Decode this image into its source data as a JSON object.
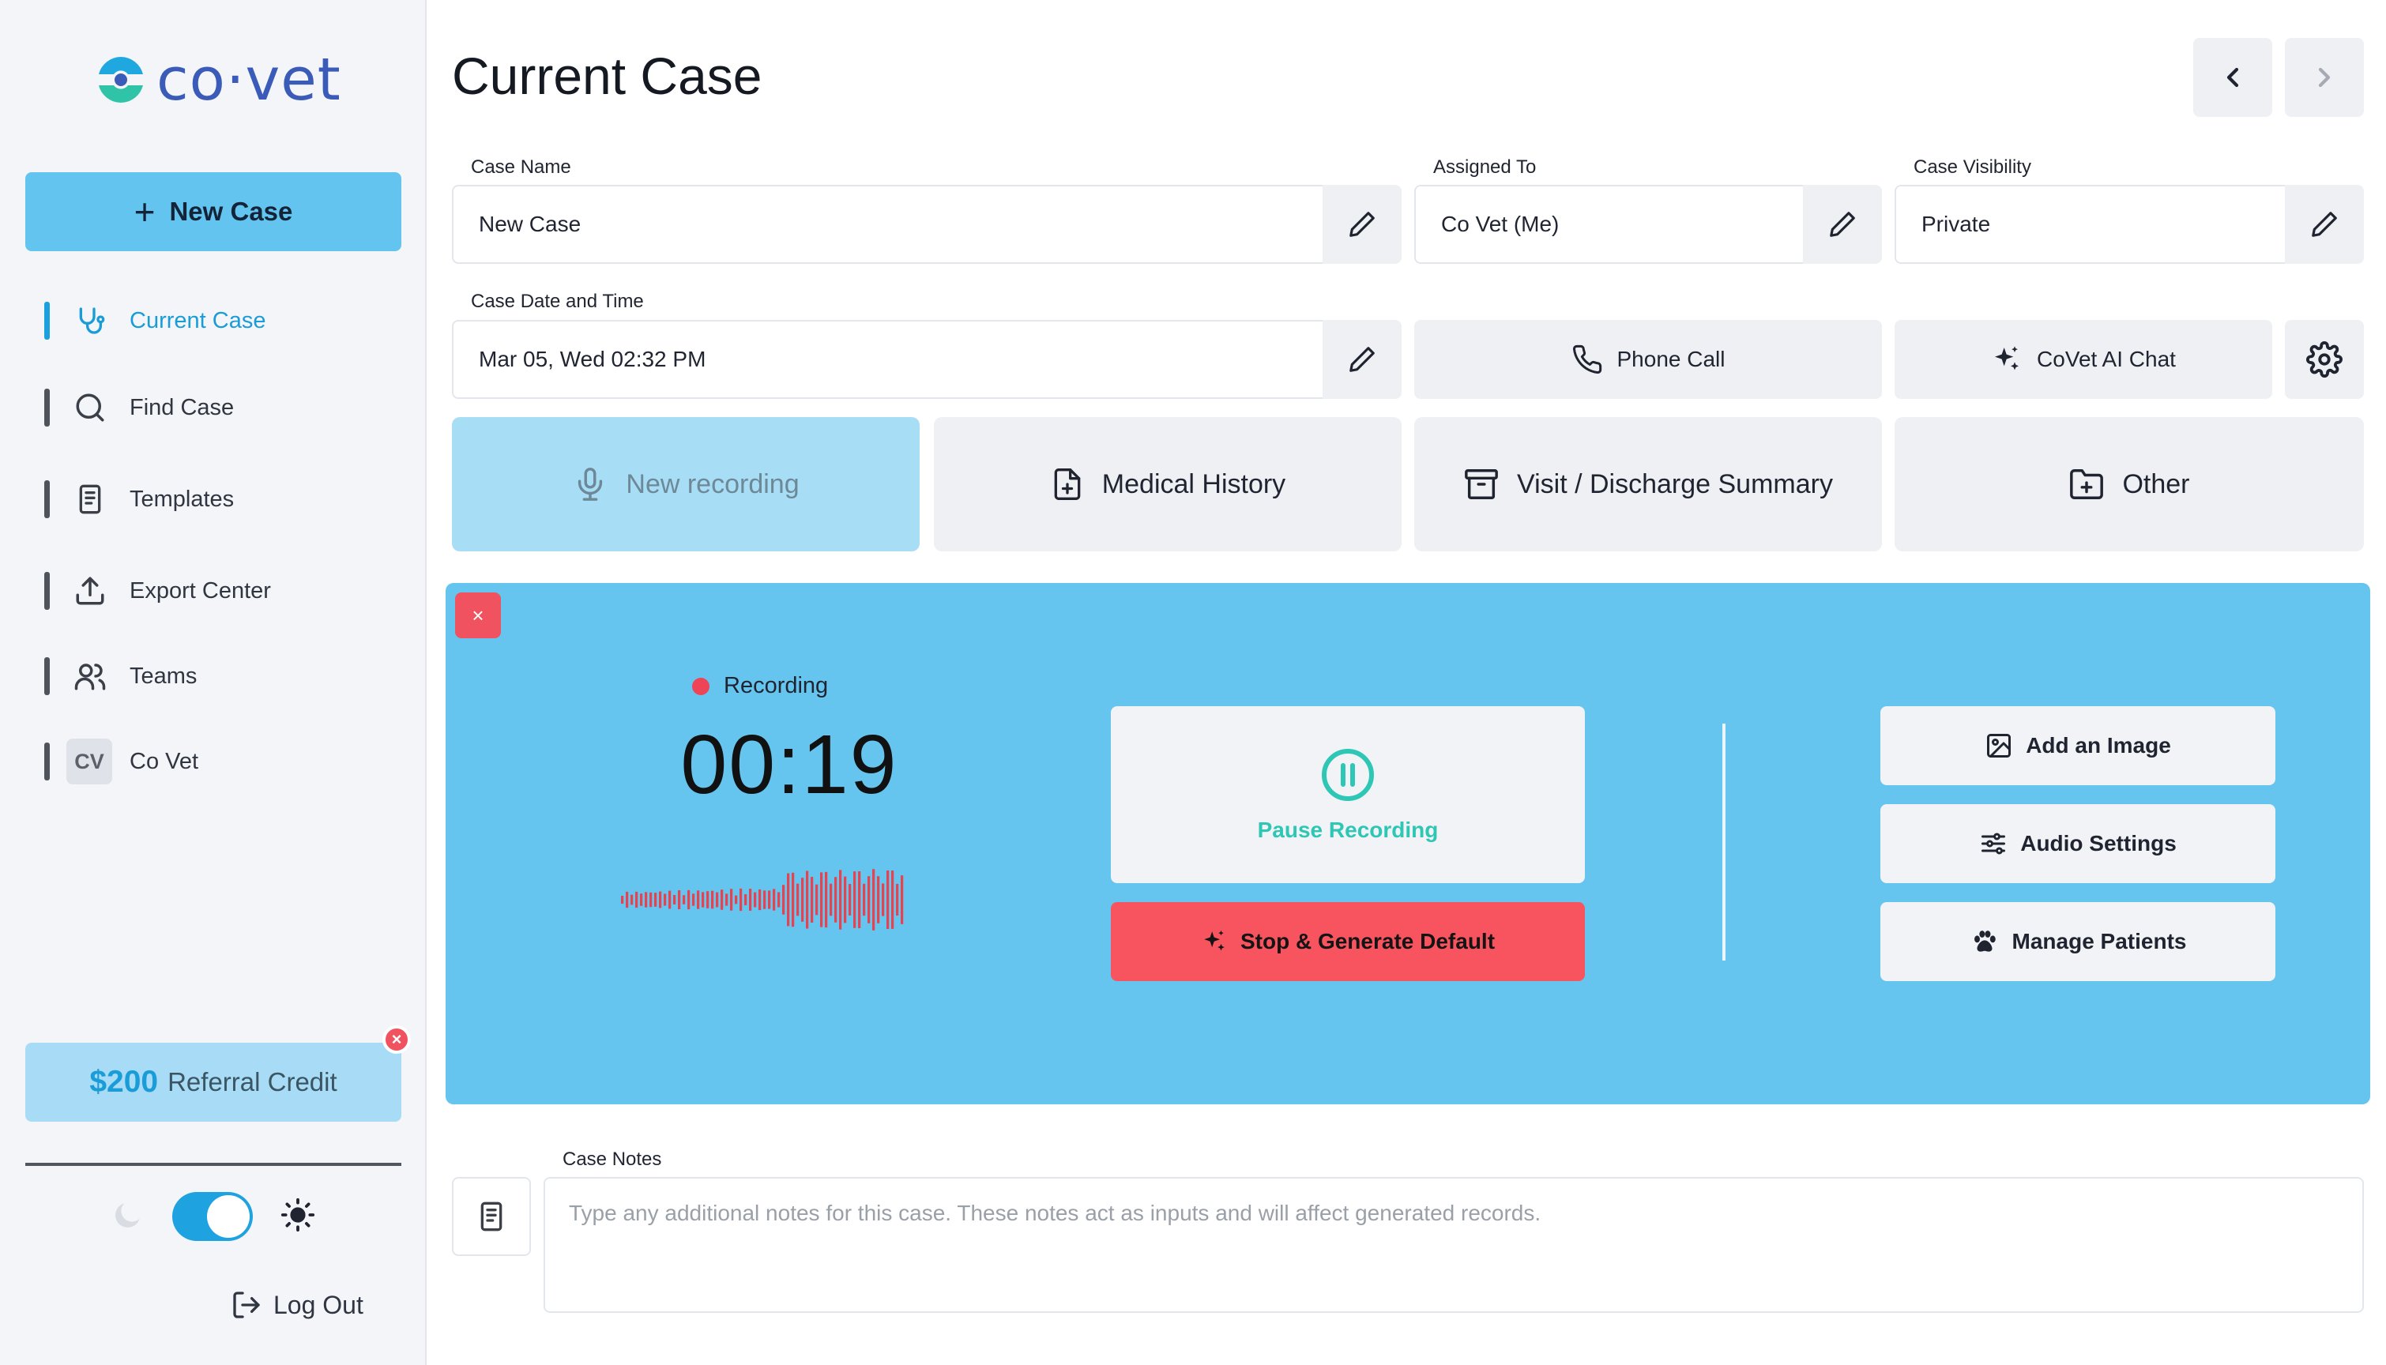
{
  "sidebar": {
    "logo_text": "co·vet",
    "new_case_label": "New Case",
    "items": [
      {
        "label": "Current Case",
        "icon": "stethoscope-icon",
        "active": true
      },
      {
        "label": "Find Case",
        "icon": "search-icon"
      },
      {
        "label": "Templates",
        "icon": "document-icon"
      },
      {
        "label": "Export Center",
        "icon": "upload-icon"
      },
      {
        "label": "Teams",
        "icon": "users-icon"
      },
      {
        "label": "Co Vet",
        "icon": "avatar",
        "avatar_initials": "CV"
      }
    ],
    "referral": {
      "amount": "$200",
      "label": "Referral Credit"
    },
    "logout_label": "Log Out"
  },
  "header": {
    "title": "Current Case"
  },
  "fields": {
    "case_name": {
      "label": "Case Name",
      "value": "New Case"
    },
    "assigned_to": {
      "label": "Assigned To",
      "value": "Co Vet (Me)"
    },
    "visibility": {
      "label": "Case Visibility",
      "value": "Private"
    },
    "date_time": {
      "label": "Case Date and Time",
      "value": "Mar 05, Wed 02:32 PM"
    }
  },
  "actions": {
    "phone_call": "Phone Call",
    "ai_chat": "CoVet AI Chat"
  },
  "tabs": [
    {
      "label": "New recording",
      "icon": "microphone-icon",
      "active": true
    },
    {
      "label": "Medical History",
      "icon": "file-plus-icon"
    },
    {
      "label": "Visit / Discharge Summary",
      "icon": "archive-icon"
    },
    {
      "label": "Other",
      "icon": "folder-plus-icon"
    }
  ],
  "recording": {
    "status": "Recording",
    "timer": "00:19",
    "pause_label": "Pause Recording",
    "stop_label": "Stop & Generate Default",
    "side_buttons": [
      "Add an Image",
      "Audio Settings",
      "Manage Patients"
    ],
    "close_glyph": "×"
  },
  "notes": {
    "label": "Case Notes",
    "placeholder": "Type any additional notes for this case. These notes act as inputs and will affect generated records."
  },
  "colors": {
    "accent": "#1aa0dd",
    "new_case_button": "#63c4f0",
    "recording_panel": "#66c5ef",
    "stop_button": "#f8545f",
    "pause_accent": "#2ec6b4",
    "recording_dot": "#ee4556"
  }
}
